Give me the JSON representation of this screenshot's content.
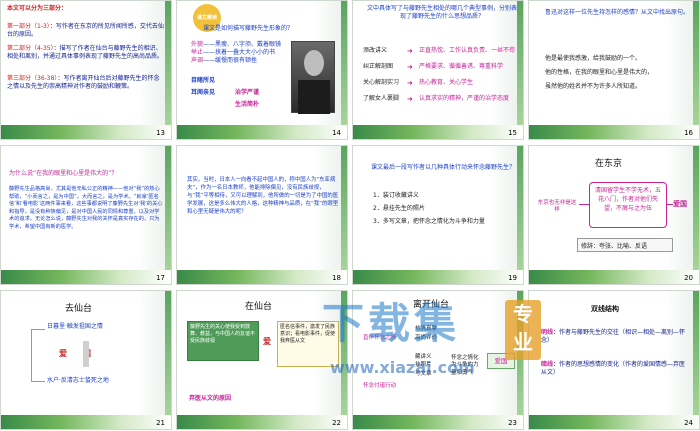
{
  "slides": {
    "s13": {
      "number": "13",
      "heading": "本文可以分为三部分：",
      "p1_label": "第一部分（1-3）",
      "p1_text": "：写作者在东京的所见所闻所感，交代去仙台的原因。",
      "p2_label": "第二部分（4-35）",
      "p2_text": "：描写了作者在仙台与藤野先生的相识、相处和离别，并通过具体事例表现了藤野先生的高尚品质。",
      "p3_label": "第三部分（36-38）",
      "p3_text": "：写作者离开仙台后对藤野先生的怀念之情以及先生的崇高精神对作者的鼓励和鞭策。"
    },
    "s14": {
      "number": "14",
      "badge": "课文精读",
      "question": "课文是如何描写藤野先生形象的？",
      "rows": [
        {
          "label": "外貌",
          "text": "——黑瘦、八字须、戴着眼镜"
        },
        {
          "label": "举止",
          "text": "——挟着一叠大大小小的书"
        },
        {
          "label": "声调",
          "text": "——缓慢而很有顿挫"
        }
      ],
      "left1": "目睹所见",
      "left2": "耳闻亲见",
      "right1": "治学严谨",
      "right2": "生活简朴"
    },
    "s15": {
      "number": "15",
      "question": "文中具体写了与藤野先生相处的哪几个典型事例，分别表现了藤野先生的什么思想品质？",
      "rows": [
        {
          "left": "添改讲义",
          "right": "正直热忱、工作认真负责、一丝不苟"
        },
        {
          "left": "纠正解剖图",
          "right": "严格要求、循循善诱、尊重科学"
        },
        {
          "left": "关心解剖实习",
          "right": "热心教育、关心学生"
        },
        {
          "left": "了解女人裹脚",
          "right": "认真求实的精神，严谨的治学态度"
        }
      ]
    },
    "s16": {
      "number": "16",
      "question": "鲁迅对这样一位先生持怎样的感情？从文中找出原句。",
      "lines": [
        "他是最使我感激，给我鼓励的一个。",
        "他的性格，在我的眼里和心里是伟大的，",
        "虽然他的姓名并不为许多人所知道。"
      ]
    },
    "s17": {
      "number": "17",
      "question": "为什么说“在我的眼里和心里是伟大的”？",
      "body": "藤野先生品格高尚，尤其是他无私公正的精神——他对“我”的热心帮助，“小而言之，是为中国”，大而言之，是为学术。“就拿‘匿名信’和‘看电影’这两件事来看，这些事都说明了藤野先生对‘我’的关心和指导，是没有种族偏见，是对中国人民的同情和尊重，以及对学术的追求。无论怎么说，藤野先生对我的关怀是真实存在的，只为学术，希望中国有新的医学。"
    },
    "s18": {
      "number": "18",
      "body": "其实，当时，日本人一向看不起中国人的，称中国人为“东亚病夫”，作为一名日本教师，他能排除偏见，没有民族歧视，与“我”平等相待，又可以理解到，他所做的一切是为了中国的医学发展，这是多么伟大的人格，这种精神与品质，在“我”的眼里和心里无疑是伟大的呢？"
    },
    "s19": {
      "number": "19",
      "question": "课文最后一段写作者以几种具体行动来怀念藤野先生？",
      "items": [
        "1．装订收藏讲义",
        "2．悬挂先生的照片",
        "3．多写文章，把怀念之情化为斗争和力量"
      ]
    },
    "s20": {
      "number": "20",
      "title": "在东京",
      "left": "东京也无非是这样",
      "middle": "清国留学生不学无术，五花八门，作者对他们失望，不屑与之为伍",
      "right": "爱国",
      "bottom": "修辞：夸张、比喻、反语"
    },
    "s21": {
      "number": "21",
      "title": "去仙台",
      "top": "日暮里·触发祖国之情",
      "middle": "爱　　国",
      "bottom": "水户·反清志士蛰死之地"
    },
    "s22": {
      "number": "22",
      "title": "在仙台",
      "block1": "藤野先生的关心使我受到鼓舞、教益，与中国人的友谊不受民族歧视",
      "block2": "爱",
      "block3": "匿名信事件，激发了民族意识；看电影事件，促使我弃医从文",
      "bottom": "弃医从文的原因"
    },
    "s23": {
      "number": "23",
      "title": "离开仙台",
      "left1": "直怀怀念之情",
      "left2": "怀念付诸行动",
      "mid": [
        "热情真挚",
        "高尚评价",
        "藏讲义",
        "挂照片",
        "写文章"
      ],
      "center": "怀念之情化为斗争的力量和勇气",
      "right": "爱国"
    },
    "s24": {
      "number": "24",
      "title": "双线结构",
      "line1_label": "明线：",
      "line1_text": "作者与藤野先生的交往（相识—相处—离别—怀念）",
      "line2_label": "暗线：",
      "line2_text": "作者的思想感情的变化（作者的爱国情感—弃医从文）"
    }
  },
  "watermark": {
    "text": "下载集",
    "badge": "专业",
    "url": "www.xiazai.com"
  },
  "colors": {
    "accent_green": "#3a8a4a",
    "red": "#cc2222",
    "blue": "#1d40c8",
    "magenta": "#c8239a"
  }
}
